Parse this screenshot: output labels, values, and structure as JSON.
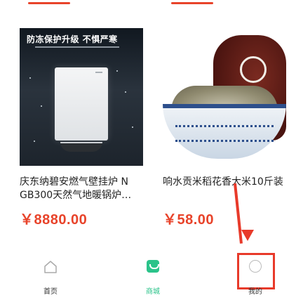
{
  "products": [
    {
      "banner": "防冻保护升级 不惧严寒",
      "title_line1": "庆东纳碧安燃气壁挂炉 N",
      "title_line2": "GB300天然气地暖锅炉…",
      "price": "￥8880.00",
      "image_icon": "wall-heater-image"
    },
    {
      "title_line1": "响水贡米稻花香大米10斤装",
      "price": "￥58.00",
      "image_icon": "rice-bowl-image"
    }
  ],
  "nav": {
    "items": [
      {
        "label": "首页",
        "icon": "home-icon"
      },
      {
        "label": "商城",
        "icon": "shop-icon"
      },
      {
        "label": "我的",
        "icon": "profile-icon"
      }
    ],
    "active_color": "#2bc38a"
  },
  "annotation_color": "#e83a2a",
  "price_color": "#e8432a"
}
